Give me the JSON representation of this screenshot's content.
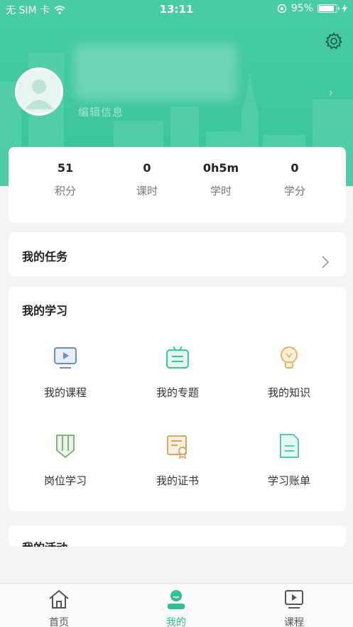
{
  "status_bar": {
    "carrier": "无 SIM 卡",
    "time": "13:11",
    "battery": "95%"
  },
  "profile": {
    "edit_info": "编辑信息"
  },
  "stats": [
    {
      "value": "51",
      "label": "积分"
    },
    {
      "value": "0",
      "label": "课时"
    },
    {
      "value": "0h5m",
      "label": "学时"
    },
    {
      "value": "0",
      "label": "学分"
    }
  ],
  "tasks": {
    "title": "我的任务"
  },
  "study": {
    "title": "我的学习",
    "items": [
      {
        "label": "我的课程",
        "icon": "course-play-icon"
      },
      {
        "label": "我的专题",
        "icon": "topic-icon"
      },
      {
        "label": "我的知识",
        "icon": "lightbulb-icon"
      },
      {
        "label": "岗位学习",
        "icon": "pencil-icon"
      },
      {
        "label": "我的证书",
        "icon": "certificate-icon"
      },
      {
        "label": "学习账单",
        "icon": "bill-icon"
      }
    ]
  },
  "activity": {
    "title": "我的活动"
  },
  "tabbar": {
    "items": [
      {
        "label": "首页",
        "icon": "home-icon"
      },
      {
        "label": "我的",
        "icon": "profile-icon"
      },
      {
        "label": "课程",
        "icon": "course-icon"
      }
    ],
    "active_index": 1
  },
  "colors": {
    "brand": "#37c39a",
    "active_tab": "#2fbf94"
  }
}
